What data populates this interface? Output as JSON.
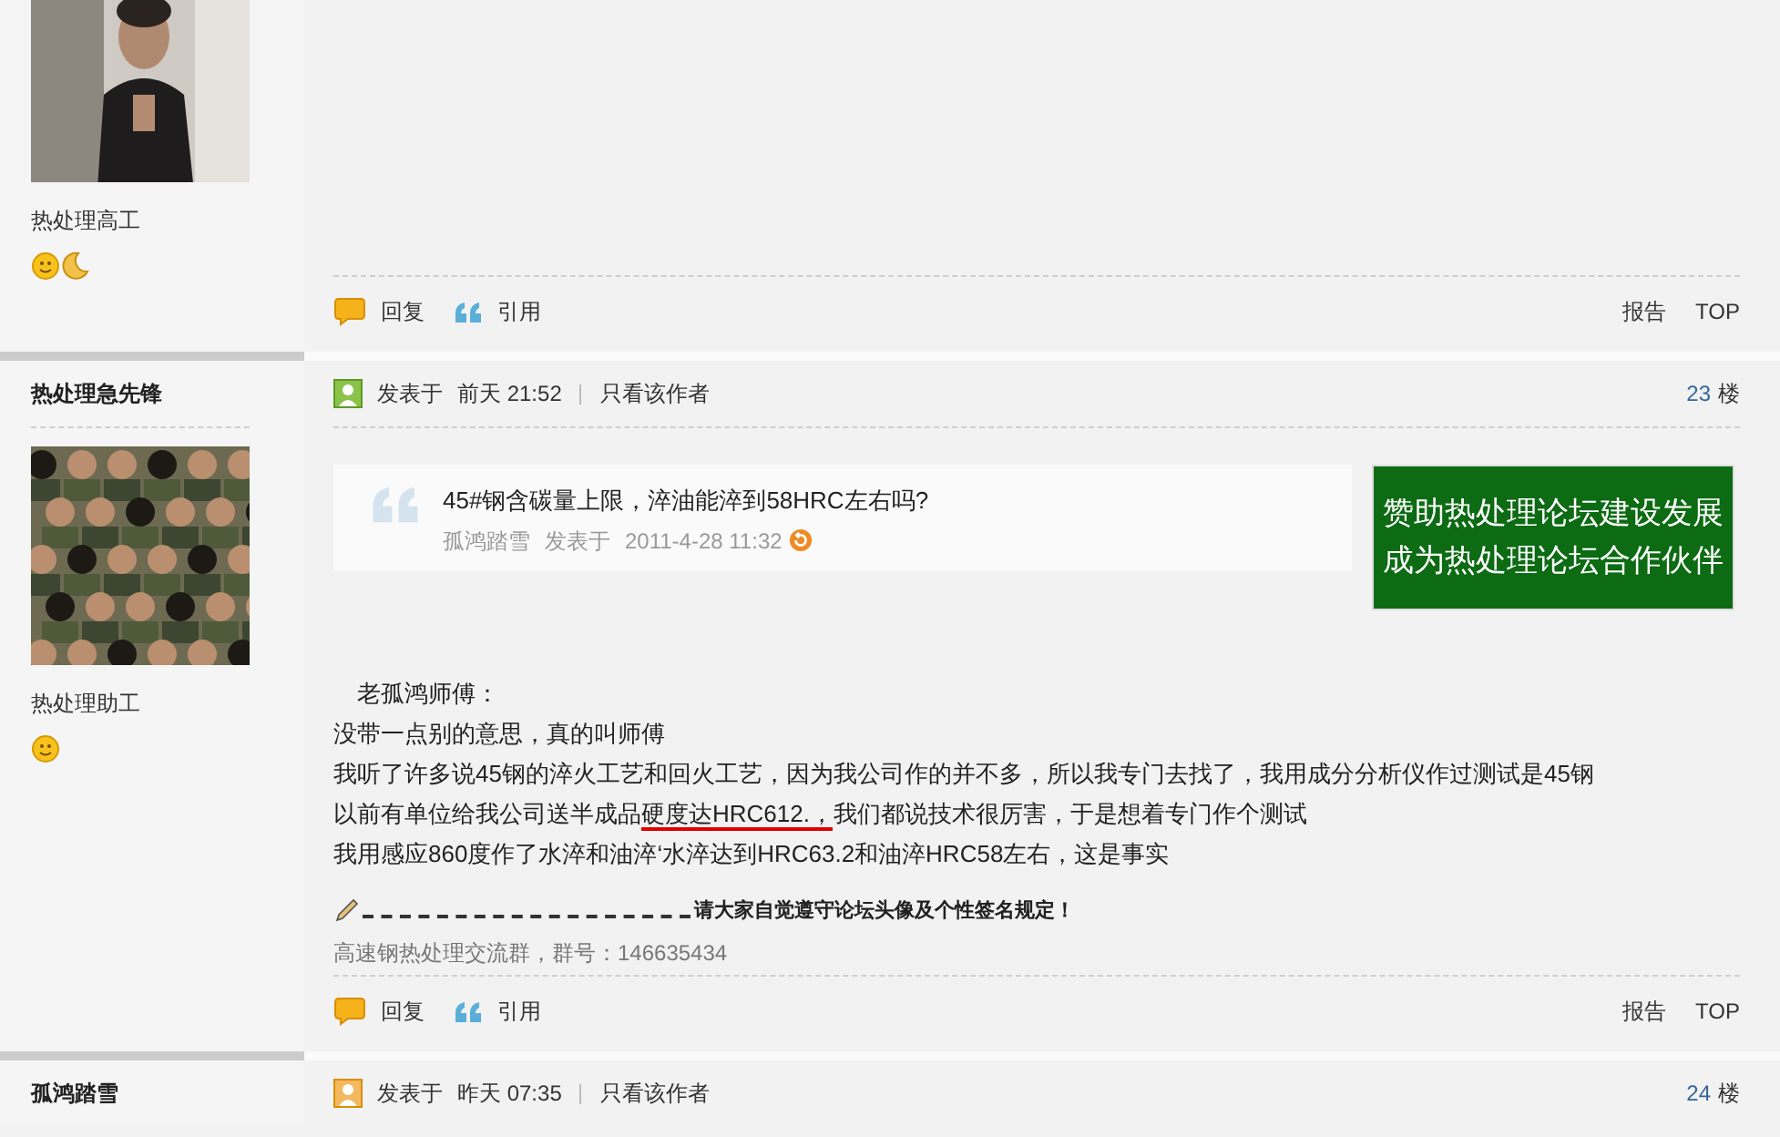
{
  "posts": [
    {
      "rank": "热处理高工",
      "badges": [
        {
          "kind": "sun"
        },
        {
          "kind": "moon"
        }
      ],
      "actions": [
        {
          "kind": "reply",
          "label": "回复"
        },
        {
          "kind": "quote",
          "label": "引用"
        }
      ],
      "links": [
        "报告",
        "TOP"
      ]
    },
    {
      "author": "热处理急先锋",
      "posted_label": "发表于",
      "time": "前天 21:52",
      "author_only": "只看该作者",
      "floor": "23",
      "floor_unit": "楼",
      "rank": "热处理助工",
      "badges": [
        {
          "kind": "sun"
        }
      ],
      "quote": {
        "title": "45#钢含碳量上限，淬油能淬到58HRC左右吗?",
        "author": "孤鸿踏雪",
        "posted_label": "发表于",
        "time": "2011-4-28 11:32"
      },
      "ad": [
        "赞助热处理论坛建设发展",
        "成为热处理论坛合作伙伴"
      ],
      "lines": [
        {
          "indent": true,
          "parts": [
            {
              "text": "老孤鸿师傅：",
              "underlined": false
            }
          ]
        },
        {
          "indent": false,
          "parts": [
            {
              "text": "没带一点别的意思，真的叫师傅",
              "underlined": false
            }
          ]
        },
        {
          "indent": false,
          "parts": [
            {
              "text": "我听了许多说45钢的淬火工艺和回火工艺，因为我公司作的并不多，所以我专门去找了，我用成分分析仪作过测试是45钢",
              "underlined": false
            }
          ]
        },
        {
          "indent": false,
          "parts": [
            {
              "text": "以前有单位给我公司送半成品",
              "underlined": false
            },
            {
              "text": "硬度达HRC612.，",
              "underlined": true
            },
            {
              "text": "我们都说技术很厉害，于是想着专门作个测试",
              "underlined": false
            }
          ]
        },
        {
          "indent": false,
          "parts": [
            {
              "text": "我用感应860度作了水淬和油淬‘水淬达到HRC63.2和油淬HRC58左右，这是事实",
              "underlined": false
            }
          ]
        }
      ],
      "signature": {
        "notice": "请大家自觉遵守论坛头像及个性签名规定！",
        "group": "高速钢热处理交流群，群号：146635434"
      },
      "actions": [
        {
          "kind": "reply",
          "label": "回复"
        },
        {
          "kind": "quote",
          "label": "引用"
        }
      ],
      "links": [
        "报告",
        "TOP"
      ]
    },
    {
      "author": "孤鸿踏雪",
      "posted_label": "发表于",
      "time": "昨天 07:35",
      "author_only": "只看该作者",
      "floor": "24",
      "floor_unit": "楼"
    }
  ]
}
